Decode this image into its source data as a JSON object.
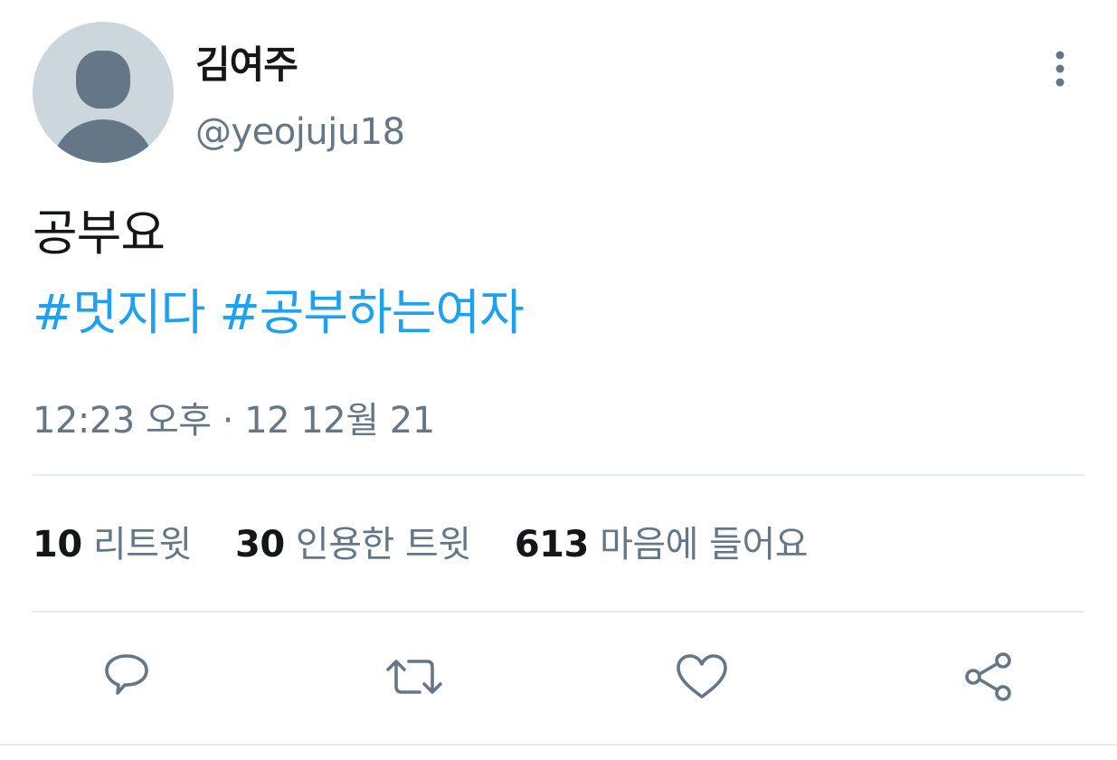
{
  "user": {
    "display_name": "김여주",
    "handle": "@yeojuju18"
  },
  "tweet": {
    "text": "공부요",
    "hashtags": [
      "#멋지다",
      "#공부하는여자"
    ],
    "timestamp": "12:23 오후 · 12 12월 21"
  },
  "stats": {
    "retweets_count": "10",
    "retweets_label": "리트윗",
    "quotes_count": "30",
    "quotes_label": "인용한 트윗",
    "likes_count": "613",
    "likes_label": "마음에 들어요"
  },
  "icons": {
    "more": "more-vertical-icon",
    "reply": "reply-icon",
    "retweet": "retweet-icon",
    "like": "heart-icon",
    "share": "share-icon"
  },
  "colors": {
    "text_primary": "#14171a",
    "text_secondary": "#657786",
    "link": "#1da1f2",
    "divider": "#e6ecf0",
    "avatar_bg": "#ccd6dd",
    "avatar_fg": "#657786"
  }
}
